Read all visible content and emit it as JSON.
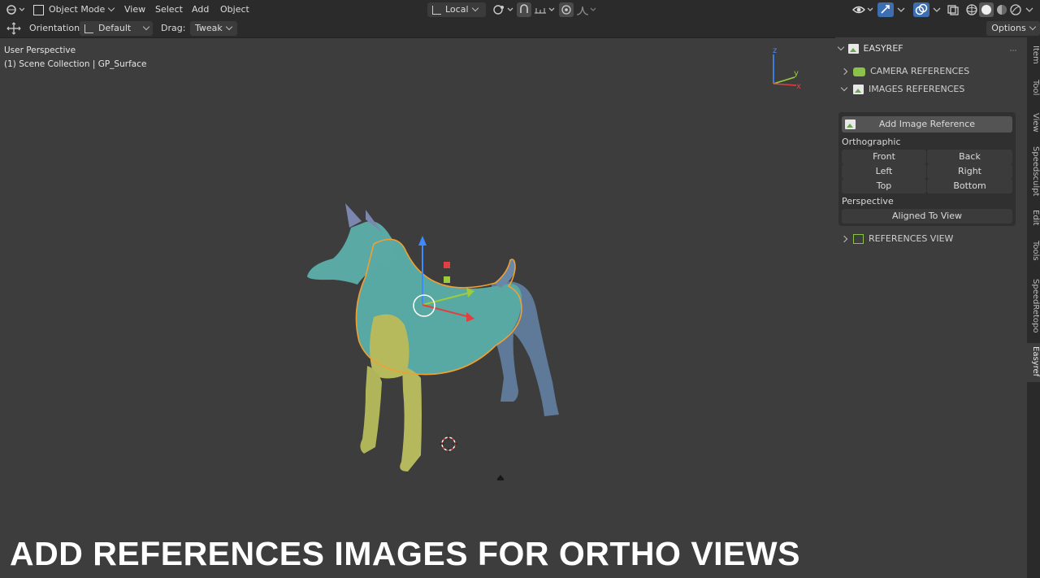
{
  "header": {
    "mode": "Object Mode",
    "menus": [
      "View",
      "Select",
      "Add",
      "Object"
    ],
    "transform_orientation": "Local"
  },
  "toolbar": {
    "orientation_label": "Orientation:",
    "orientation_value": "Default",
    "drag_label": "Drag:",
    "drag_value": "Tweak",
    "options": "Options"
  },
  "viewport": {
    "view_name": "User Perspective",
    "collection_path": "(1) Scene Collection | GP_Surface",
    "axes": {
      "x": "x",
      "y": "y",
      "z": "z"
    }
  },
  "panel": {
    "title": "EASYREF",
    "camera_refs": "CAMERA REFERENCES",
    "image_refs": "IMAGES REFERENCES",
    "add_image": "Add Image Reference",
    "orthographic_label": "Orthographic",
    "ortho_buttons": [
      "Front",
      "Back",
      "Left",
      "Right",
      "Top",
      "Bottom"
    ],
    "perspective_label": "Perspective",
    "aligned_to_view": "Aligned To View",
    "references_view": "REFERENCES VIEW"
  },
  "side_tabs": [
    "Item",
    "Tool",
    "View",
    "Speedsculpt",
    "Edit",
    "Tools",
    "SpeedRetopo",
    "Easyref"
  ],
  "caption": "ADD REFERENCES IMAGES FOR ORTHO VIEWS",
  "colors": {
    "accent_green": "#8bc34a",
    "selection_orange": "#f0a030",
    "gizmo_blue": "#3d8bff",
    "gizmo_red": "#e04040",
    "gizmo_green": "#9ccc3a"
  }
}
